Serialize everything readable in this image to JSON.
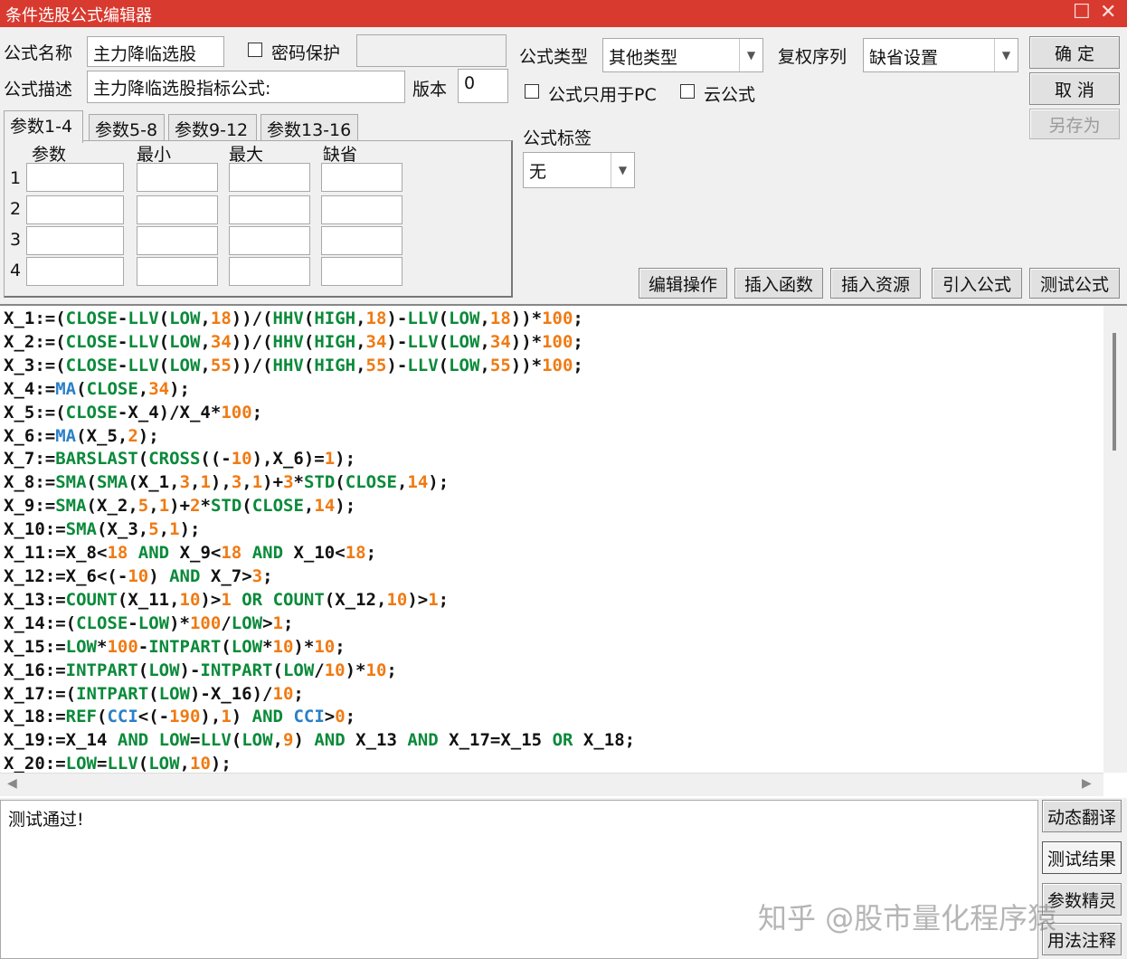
{
  "window": {
    "title": "条件选股公式编辑器"
  },
  "icons": {
    "maximize": "maximize-icon",
    "close": "close-icon",
    "dropdown": "chevron-down-icon"
  },
  "form": {
    "name_label": "公式名称",
    "name_value": "主力降临选股",
    "password_label": "密码保护",
    "password_checked": false,
    "password_value": "",
    "desc_label": "公式描述",
    "desc_value": "主力降临选股指标公式:",
    "version_label": "版本",
    "version_value": "0",
    "type_label": "公式类型",
    "type_value": "其他类型",
    "rights_label": "复权序列",
    "rights_value": "缺省设置",
    "pc_only_label": "公式只用于PC",
    "pc_only_checked": false,
    "cloud_label": "云公式",
    "cloud_checked": false,
    "tag_label": "公式标签",
    "tag_value": "无"
  },
  "buttons": {
    "ok": "确  定",
    "cancel": "取  消",
    "save_as": "另存为",
    "edit_ops": "编辑操作",
    "insert_func": "插入函数",
    "insert_resource": "插入资源",
    "import_formula": "引入公式",
    "test_formula": "测试公式",
    "dynamic_translate": "动态翻译",
    "test_result": "测试结果",
    "param_wizard": "参数精灵",
    "usage_notes": "用法注释"
  },
  "param_tabs": [
    "参数1-4",
    "参数5-8",
    "参数9-12",
    "参数13-16"
  ],
  "param_headers": [
    "参数",
    "最小",
    "最大",
    "缺省"
  ],
  "param_rows": [
    {
      "index": "1",
      "name": "",
      "min": "",
      "max": "",
      "default": ""
    },
    {
      "index": "2",
      "name": "",
      "min": "",
      "max": "",
      "default": ""
    },
    {
      "index": "3",
      "name": "",
      "min": "",
      "max": "",
      "default": ""
    },
    {
      "index": "4",
      "name": "",
      "min": "",
      "max": "",
      "default": ""
    }
  ],
  "code_lines": [
    "X_1:=(CLOSE-LLV(LOW,18))/(HHV(HIGH,18)-LLV(LOW,18))*100;",
    "X_2:=(CLOSE-LLV(LOW,34))/(HHV(HIGH,34)-LLV(LOW,34))*100;",
    "X_3:=(CLOSE-LLV(LOW,55))/(HHV(HIGH,55)-LLV(LOW,55))*100;",
    "X_4:=MA(CLOSE,34);",
    "X_5:=(CLOSE-X_4)/X_4*100;",
    "X_6:=MA(X_5,2);",
    "X_7:=BARSLAST(CROSS((-10),X_6)=1);",
    "X_8:=SMA(SMA(X_1,3,1),3,1)+3*STD(CLOSE,14);",
    "X_9:=SMA(X_2,5,1)+2*STD(CLOSE,14);",
    "X_10:=SMA(X_3,5,1);",
    "X_11:=X_8<18 AND X_9<18 AND X_10<18;",
    "X_12:=X_6<(-10) AND X_7>3;",
    "X_13:=COUNT(X_11,10)>1 OR COUNT(X_12,10)>1;",
    "X_14:=(CLOSE-LOW)*100/LOW>1;",
    "X_15:=LOW*100-INTPART(LOW*10)*10;",
    "X_16:=INTPART(LOW)-INTPART(LOW/10)*10;",
    "X_17:=(INTPART(LOW)-X_16)/10;",
    "X_18:=REF(CCI<(-190),1) AND CCI>0;",
    "X_19:=X_14 AND LOW=LLV(LOW,9) AND X_13 AND X_17=X_15 OR X_18;",
    "X_20:=LOW=LLV(LOW,10);"
  ],
  "output": {
    "text": "测试通过!"
  },
  "watermark": "知乎 @股市量化程序猿",
  "colors": {
    "titlebar": "#d83a2f",
    "code_function": "#0a8a3a",
    "code_ma": "#2a80c8",
    "code_number": "#f07a12"
  }
}
